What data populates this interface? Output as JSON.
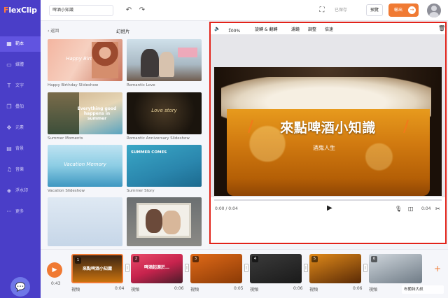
{
  "app": {
    "logo_prefix": "F",
    "logo_rest": "lexClip",
    "project_name": "啤酒小知識",
    "saved_label": "已保存",
    "preview_label": "預覽",
    "export_label": "輸出",
    "accent_color": "#f07a33",
    "sidebar_color": "#4a3ec8"
  },
  "sidebar": {
    "items": [
      {
        "label": "範本",
        "icon": "template-icon",
        "glyph": "▦"
      },
      {
        "label": "媒體",
        "icon": "media-icon",
        "glyph": "▭"
      },
      {
        "label": "文字",
        "icon": "text-icon",
        "glyph": "T"
      },
      {
        "label": "疊加",
        "icon": "overlay-icon",
        "glyph": "❐"
      },
      {
        "label": "元素",
        "icon": "elements-icon",
        "glyph": "✥"
      },
      {
        "label": "背景",
        "icon": "background-icon",
        "glyph": "▤"
      },
      {
        "label": "音樂",
        "icon": "music-icon",
        "glyph": "♫"
      },
      {
        "label": "浮水印",
        "icon": "watermark-icon",
        "glyph": "◈"
      },
      {
        "label": "更多",
        "icon": "more-icon",
        "glyph": "···"
      }
    ]
  },
  "panel": {
    "back_label": "‹ 返回",
    "title": "幻燈片",
    "templates": [
      {
        "caption": "Happy Birthday Slideshow",
        "overlay": "Happy Birthday"
      },
      {
        "caption": "Romantic Love",
        "overlay": ""
      },
      {
        "caption": "Summer Moments",
        "overlay": "Everything good happens in summer"
      },
      {
        "caption": "Romantic Anniversary Slideshow",
        "overlay": "Love story"
      },
      {
        "caption": "Vacation Slideshow",
        "overlay": "Vacation Memory"
      },
      {
        "caption": "Summer Story",
        "overlay": "SUMMER COMES"
      },
      {
        "caption": "",
        "overlay": ""
      },
      {
        "caption": "",
        "overlay": ""
      }
    ]
  },
  "preview": {
    "zoom": "100%",
    "tools": [
      "旋轉 & 翻轉",
      "濾鏡",
      "調整",
      "倍速"
    ],
    "title": "來點啤酒小知識",
    "subtitle": "酒鬼人生",
    "time_current": "0:00 / 0:04",
    "time_total": "0:04",
    "progress": 0
  },
  "timeline": {
    "current_time": "0:43",
    "clips": [
      {
        "num": "1",
        "text": "來點啤酒小知識",
        "label": "視頻",
        "duration": "0:04"
      },
      {
        "num": "2",
        "text": "啤酒起源於…",
        "label": "視頻",
        "duration": "0:06"
      },
      {
        "num": "3",
        "text": "",
        "label": "視頻",
        "duration": "0:05"
      },
      {
        "num": "4",
        "text": "",
        "label": "視頻",
        "duration": "0:06"
      },
      {
        "num": "5",
        "text": "",
        "label": "視頻",
        "duration": "0:06"
      },
      {
        "num": "6",
        "text": "",
        "label": "視頻",
        "duration": ""
      }
    ]
  },
  "watermark": "布蘭特大叔"
}
